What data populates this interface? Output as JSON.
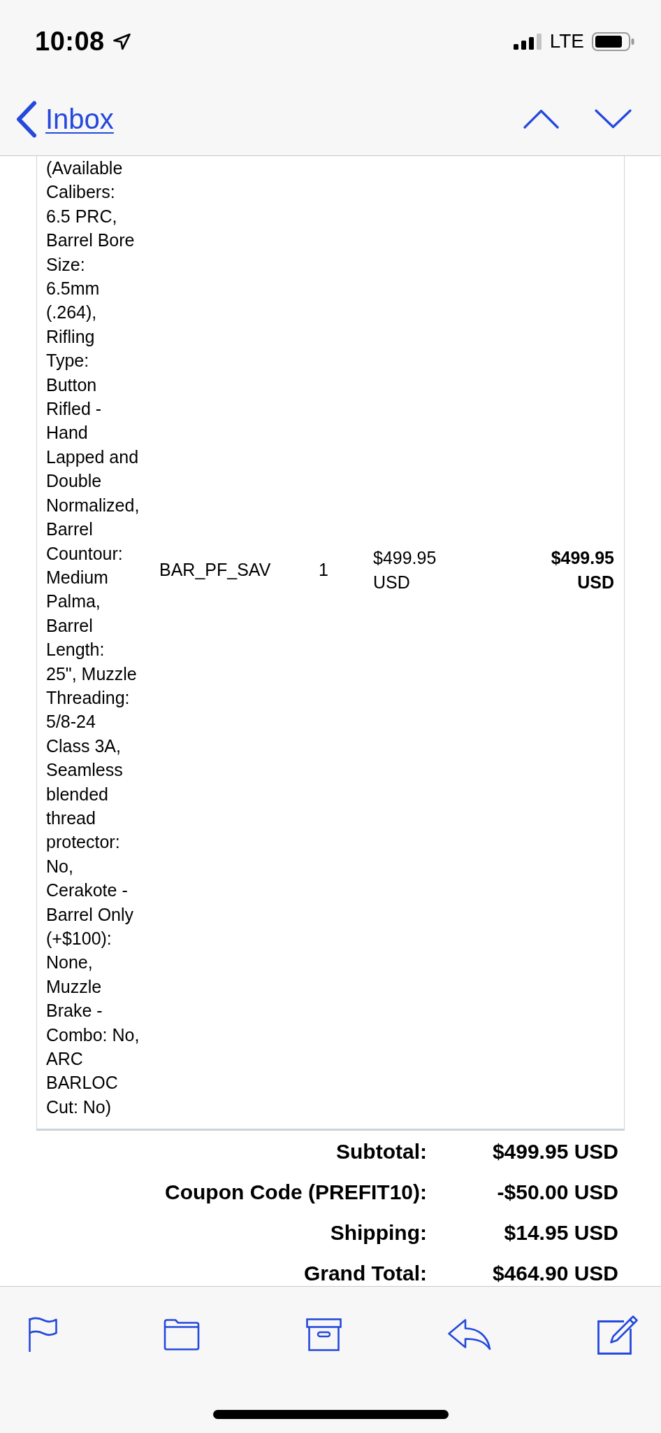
{
  "status_bar": {
    "time": "10:08",
    "network": "LTE"
  },
  "nav_bar": {
    "back_label": "Inbox"
  },
  "order_table": {
    "rows": [
      {
        "description": "(Available Calibers: 6.5 PRC, Barrel Bore Size: 6.5mm (.264), Rifling Type: Button Rifled - Hand Lapped and Double Normalized, Barrel Countour: Medium Palma, Barrel Length: 25\", Muzzle Threading: 5/8-24 Class 3A, Seamless blended thread protector: No, Cerakote - Barrel Only (+$100): None, Muzzle Brake - Combo: No, ARC BARLOC Cut: No)",
        "sku": "BAR_PF_SAV",
        "quantity": "1",
        "unit_price": "$499.95 USD",
        "total": "$499.95 USD"
      }
    ]
  },
  "totals": [
    {
      "label": "Subtotal:",
      "value": "$499.95 USD"
    },
    {
      "label": "Coupon Code (PREFIT10):",
      "value": "-$50.00 USD"
    },
    {
      "label": "Shipping:",
      "value": "$14.95 USD"
    },
    {
      "label": "Grand Total:",
      "value": "$464.90 USD"
    }
  ]
}
